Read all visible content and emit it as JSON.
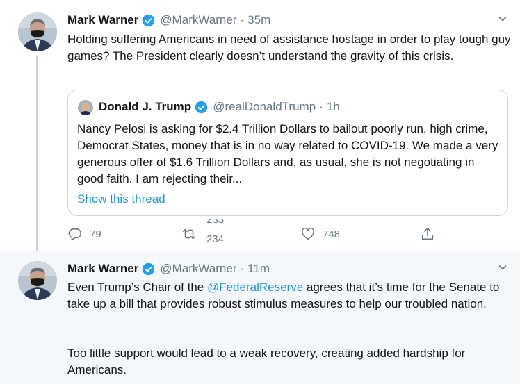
{
  "tweet1": {
    "name": "Mark Warner",
    "handle": "@MarkWarner",
    "separator": "·",
    "time": "35m",
    "text": "Holding suffering Americans in need of assistance hostage in order to play tough guy games? The President clearly doesn’t understand the gravity of this crisis.",
    "quote": {
      "name": "Donald J. Trump",
      "handle": "@realDonaldTrump",
      "separator": "·",
      "time": "1h",
      "text": "Nancy Pelosi is asking for $2.4 Trillion Dollars to bailout poorly run, high crime, Democrat States, money that is in no way related to COVID-19. We made a very generous offer of $1.6 Trillion Dollars and, as usual, she is not negotiating in good faith. I am rejecting their...",
      "show_thread": "Show this thread"
    },
    "actions": {
      "reply_count": "79",
      "retweet_count_old": "233",
      "retweet_count": "234",
      "like_count": "748"
    }
  },
  "tweet2": {
    "name": "Mark Warner",
    "handle": "@MarkWarner",
    "separator": "·",
    "time": "11m",
    "text_before": "Even Trump’s Chair of the ",
    "mention": "@FederalReserve",
    "text_after": " agrees that it’s time for the Senate to take up a bill that provides robust stimulus measures to help our troubled nation.",
    "text_para2": "Too little support would lead to a weak recovery, creating added hardship for Americans."
  },
  "colors": {
    "accent": "#1b95e0",
    "secondary_text": "#657786",
    "border": "#ccd6dd",
    "highlight_bg": "#f5f8fa"
  },
  "icons": [
    "verified-badge-icon",
    "chevron-down-icon",
    "reply-icon",
    "retweet-icon",
    "like-icon",
    "share-icon"
  ]
}
